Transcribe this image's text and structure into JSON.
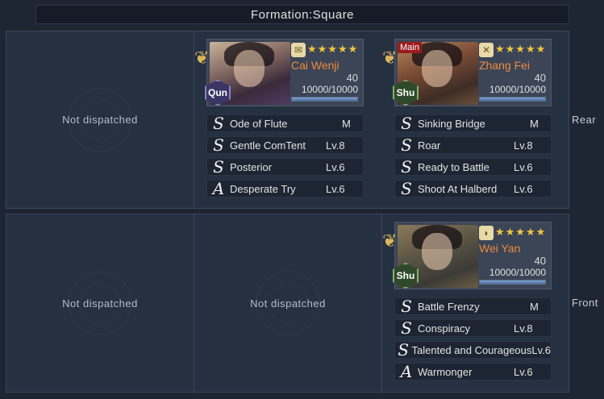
{
  "title": "Formation:Square",
  "rows": {
    "rear": {
      "label": "Rear"
    },
    "front": {
      "label": "Front"
    }
  },
  "empty_label": "Not dispatched",
  "heroes": {
    "cai": {
      "name": "Cai Wenji",
      "faction": "Qun",
      "level": "40",
      "troops": "10000/10000",
      "troop_fraction": 1.0,
      "stars": "★★★★★",
      "class_icon": "scroll-icon",
      "skills": [
        {
          "grade": "S",
          "name": "Ode of Flute",
          "level": "M"
        },
        {
          "grade": "S",
          "name": "Gentle ComTent",
          "level": "Lv.8"
        },
        {
          "grade": "S",
          "name": "Posterior",
          "level": "Lv.6"
        },
        {
          "grade": "A",
          "name": "Desperate Try",
          "level": "Lv.6"
        }
      ]
    },
    "zhang": {
      "name": "Zhang Fei",
      "faction": "Shu",
      "level": "40",
      "troops": "10000/10000",
      "troop_fraction": 1.0,
      "stars": "★★★★★",
      "badge": "Main",
      "class_icon": "crossed-spears-icon",
      "skills": [
        {
          "grade": "S",
          "name": "Sinking Bridge",
          "level": "M"
        },
        {
          "grade": "S",
          "name": "Roar",
          "level": "Lv.8"
        },
        {
          "grade": "S",
          "name": "Ready to Battle",
          "level": "Lv.6"
        },
        {
          "grade": "S",
          "name": "Shoot At Halberd",
          "level": "Lv.6"
        }
      ]
    },
    "wei": {
      "name": "Wei Yan",
      "faction": "Shu",
      "level": "40",
      "troops": "10000/10000",
      "troop_fraction": 1.0,
      "stars": "★★★★★",
      "class_icon": "bow-icon",
      "skills": [
        {
          "grade": "S",
          "name": "Battle Frenzy",
          "level": "M"
        },
        {
          "grade": "S",
          "name": "Conspiracy",
          "level": "Lv.8"
        },
        {
          "grade": "S",
          "name": "Talented and Courageous",
          "level": "Lv.6"
        },
        {
          "grade": "A",
          "name": "Warmonger",
          "level": "Lv.6"
        }
      ]
    }
  }
}
